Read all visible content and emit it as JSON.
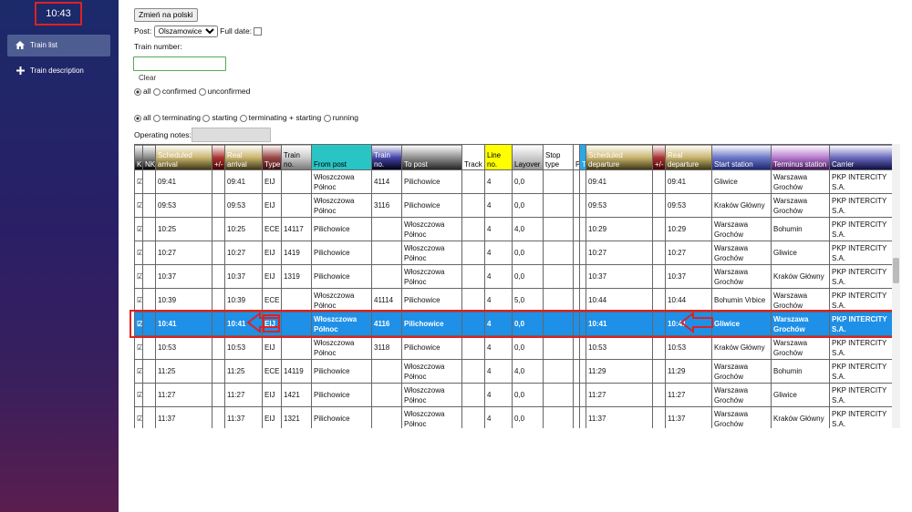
{
  "clock": "10:43",
  "sidebar": {
    "items": [
      {
        "label": "Train list",
        "icon": "home-icon"
      },
      {
        "label": "Train description",
        "icon": "plus-icon"
      }
    ]
  },
  "controls": {
    "lang_button": "Zmień na polski",
    "post_label": "Post:",
    "post_value": "Olszamowice",
    "full_date_label": "Full date:",
    "train_number_label": "Train number:",
    "clear_label": "Clear",
    "confirm_filter": [
      "all",
      "confirmed",
      "unconfirmed"
    ],
    "type_filter": [
      "all",
      "terminating",
      "starting",
      "terminating + starting",
      "running"
    ],
    "operating_notes_label": "Operating notes:"
  },
  "table": {
    "headers": [
      "K",
      "NK",
      "Scheduled arrival",
      "+/-",
      "Real arrival",
      "Type",
      "Train no.",
      "From post",
      "Train no.",
      "To post",
      "Track",
      "Line no.",
      "Layover",
      "Stop type",
      "P",
      "T",
      "Scheduled departure",
      "+/-",
      "Real departure",
      "Start station",
      "Terminus station",
      "Carrier"
    ],
    "rows": [
      {
        "k": "☑",
        "nk": "",
        "sched_arr": "09:41",
        "diff_arr": "",
        "real_arr": "09:41",
        "type": "EIJ",
        "train_in": "",
        "from": "Włoszczowa Północ",
        "train_out": "4114",
        "to": "Pilichowice",
        "track": "",
        "line": "4",
        "layover": "0,0",
        "stop": "",
        "p": "",
        "t": "",
        "sched_dep": "09:41",
        "diff_dep": "",
        "real_dep": "09:41",
        "start": "Gliwice",
        "term": "Warszawa Grochów",
        "carrier": "PKP INTERCITY S.A."
      },
      {
        "k": "☑",
        "nk": "",
        "sched_arr": "09:53",
        "diff_arr": "",
        "real_arr": "09:53",
        "type": "EIJ",
        "train_in": "",
        "from": "Włoszczowa Północ",
        "train_out": "3116",
        "to": "Pilichowice",
        "track": "",
        "line": "4",
        "layover": "0,0",
        "stop": "",
        "p": "",
        "t": "",
        "sched_dep": "09:53",
        "diff_dep": "",
        "real_dep": "09:53",
        "start": "Kraków Główny",
        "term": "Warszawa Grochów",
        "carrier": "PKP INTERCITY S.A."
      },
      {
        "k": "☑",
        "nk": "",
        "sched_arr": "10:25",
        "diff_arr": "",
        "real_arr": "10:25",
        "type": "ECE",
        "train_in": "14117",
        "from": "Pilichowice",
        "train_out": "",
        "to": "Włoszczowa Północ",
        "track": "",
        "line": "4",
        "layover": "4,0",
        "stop": "",
        "p": "",
        "t": "",
        "sched_dep": "10:29",
        "diff_dep": "",
        "real_dep": "10:29",
        "start": "Warszawa Grochów",
        "term": "Bohumin",
        "carrier": "PKP INTERCITY S.A."
      },
      {
        "k": "☑",
        "nk": "",
        "sched_arr": "10:27",
        "diff_arr": "",
        "real_arr": "10:27",
        "type": "EIJ",
        "train_in": "1419",
        "from": "Pilichowice",
        "train_out": "",
        "to": "Włoszczowa Północ",
        "track": "",
        "line": "4",
        "layover": "0,0",
        "stop": "",
        "p": "",
        "t": "",
        "sched_dep": "10:27",
        "diff_dep": "",
        "real_dep": "10:27",
        "start": "Warszawa Grochów",
        "term": "Gliwice",
        "carrier": "PKP INTERCITY S.A."
      },
      {
        "k": "☑",
        "nk": "",
        "sched_arr": "10:37",
        "diff_arr": "",
        "real_arr": "10:37",
        "type": "EIJ",
        "train_in": "1319",
        "from": "Pilichowice",
        "train_out": "",
        "to": "Włoszczowa Północ",
        "track": "",
        "line": "4",
        "layover": "0,0",
        "stop": "",
        "p": "",
        "t": "",
        "sched_dep": "10:37",
        "diff_dep": "",
        "real_dep": "10:37",
        "start": "Warszawa Grochów",
        "term": "Kraków Główny",
        "carrier": "PKP INTERCITY S.A."
      },
      {
        "k": "☑",
        "nk": "",
        "sched_arr": "10:39",
        "diff_arr": "",
        "real_arr": "10:39",
        "type": "ECE",
        "train_in": "",
        "from": "Włoszczowa Północ",
        "train_out": "41114",
        "to": "Pilichowice",
        "track": "",
        "line": "4",
        "layover": "5,0",
        "stop": "",
        "p": "",
        "t": "",
        "sched_dep": "10:44",
        "diff_dep": "",
        "real_dep": "10:44",
        "start": "Bohumin Vrbice",
        "term": "Warszawa Grochów",
        "carrier": "PKP INTERCITY S.A."
      },
      {
        "k": "☑",
        "nk": "",
        "sched_arr": "10:41",
        "diff_arr": "",
        "real_arr": "10:41",
        "type": "EIJ",
        "train_in": "",
        "from": "Włoszczowa Północ",
        "train_out": "4116",
        "to": "Pilichowice",
        "track": "",
        "line": "4",
        "layover": "0,0",
        "stop": "",
        "p": "",
        "t": "",
        "sched_dep": "10:41",
        "diff_dep": "",
        "real_dep": "10:41",
        "start": "Gliwice",
        "term": "Warszawa Grochów",
        "carrier": "PKP INTERCITY S.A.",
        "selected": true
      },
      {
        "k": "☑",
        "nk": "",
        "sched_arr": "10:53",
        "diff_arr": "",
        "real_arr": "10:53",
        "type": "EIJ",
        "train_in": "",
        "from": "Włoszczowa Północ",
        "train_out": "3118",
        "to": "Pilichowice",
        "track": "",
        "line": "4",
        "layover": "0,0",
        "stop": "",
        "p": "",
        "t": "",
        "sched_dep": "10:53",
        "diff_dep": "",
        "real_dep": "10:53",
        "start": "Kraków Główny",
        "term": "Warszawa Grochów",
        "carrier": "PKP INTERCITY S.A."
      },
      {
        "k": "☑",
        "nk": "",
        "sched_arr": "11:25",
        "diff_arr": "",
        "real_arr": "11:25",
        "type": "ECE",
        "train_in": "14119",
        "from": "Pilichowice",
        "train_out": "",
        "to": "Włoszczowa Północ",
        "track": "",
        "line": "4",
        "layover": "4,0",
        "stop": "",
        "p": "",
        "t": "",
        "sched_dep": "11:29",
        "diff_dep": "",
        "real_dep": "11:29",
        "start": "Warszawa Grochów",
        "term": "Bohumin",
        "carrier": "PKP INTERCITY S.A."
      },
      {
        "k": "☑",
        "nk": "",
        "sched_arr": "11:27",
        "diff_arr": "",
        "real_arr": "11:27",
        "type": "EIJ",
        "train_in": "1421",
        "from": "Pilichowice",
        "train_out": "",
        "to": "Włoszczowa Północ",
        "track": "",
        "line": "4",
        "layover": "0,0",
        "stop": "",
        "p": "",
        "t": "",
        "sched_dep": "11:27",
        "diff_dep": "",
        "real_dep": "11:27",
        "start": "Warszawa Grochów",
        "term": "Gliwice",
        "carrier": "PKP INTERCITY S.A."
      },
      {
        "k": "☑",
        "nk": "",
        "sched_arr": "11:37",
        "diff_arr": "",
        "real_arr": "11:37",
        "type": "EIJ",
        "train_in": "1321",
        "from": "Pilichowice",
        "train_out": "",
        "to": "Włoszczowa Północ",
        "track": "",
        "line": "4",
        "layover": "0,0",
        "stop": "",
        "p": "",
        "t": "",
        "sched_dep": "11:37",
        "diff_dep": "",
        "real_dep": "11:37",
        "start": "Warszawa Grochów",
        "term": "Kraków Główny",
        "carrier": "PKP INTERCITY S.A."
      }
    ]
  },
  "colors": {
    "sidebar_top": "#1b2a6a",
    "sidebar_bottom": "#5a1e4e",
    "selected_row": "#1e90e8",
    "highlight": "#dd2222"
  }
}
